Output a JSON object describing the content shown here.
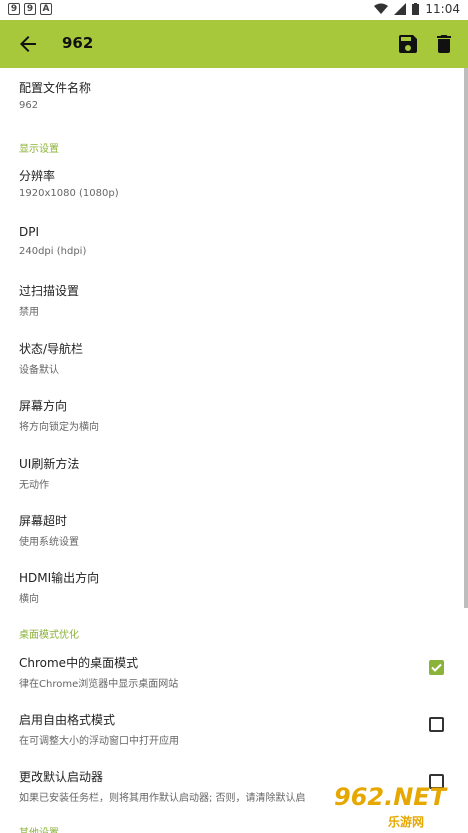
{
  "status": {
    "time": "11:04",
    "icons": [
      "9",
      "9",
      "A"
    ]
  },
  "appbar": {
    "title": "962"
  },
  "settings": [
    {
      "title": "配置文件名称",
      "sub": "962"
    },
    {
      "section": "显示设置"
    },
    {
      "title": "分辨率",
      "sub": "1920x1080 (1080p)"
    },
    {
      "title": "DPI",
      "sub": "240dpi (hdpi)"
    },
    {
      "title": "过扫描设置",
      "sub": "禁用"
    },
    {
      "title": "状态/导航栏",
      "sub": "设备默认"
    },
    {
      "title": "屏幕方向",
      "sub": "将方向锁定为横向"
    },
    {
      "title": "UI刷新方法",
      "sub": "无动作"
    },
    {
      "title": "屏幕超时",
      "sub": "使用系统设置"
    },
    {
      "title": "HDMI输出方向",
      "sub": "横向"
    },
    {
      "section": "桌面模式优化"
    },
    {
      "title": "Chrome中的桌面模式",
      "sub": "律在Chrome浏览器中显示桌面网站",
      "checked": true
    },
    {
      "title": "启用自由格式模式",
      "sub": "在可调整大小的浮动窗口中打开应用",
      "checked": false
    },
    {
      "title": "更改默认启动器",
      "sub": "如果已安装任务栏，则将其用作默认启动器; 否则，请清除默认启",
      "checked": false
    },
    {
      "section": "其他设置"
    }
  ],
  "watermark": {
    "brand": "962.NET",
    "sub": "乐游网"
  }
}
